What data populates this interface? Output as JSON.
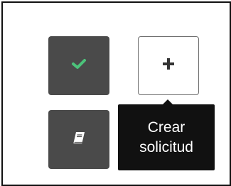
{
  "actions": [
    {
      "id": "approve",
      "icon": "checkmark-icon",
      "icon_color": "#4cc27a"
    },
    {
      "id": "create_request",
      "icon": "plus-icon",
      "icon_color": "#333333"
    },
    {
      "id": "notes",
      "icon": "book-icon",
      "icon_color": "#ffffff"
    }
  ],
  "tooltip": {
    "text": "Crear solicitud",
    "background": "#111111",
    "color": "#ffffff"
  },
  "colors": {
    "tile_dark": "#4a4a4a",
    "tile_light_border": "#6e6e6e",
    "frame_border": "#111111"
  }
}
